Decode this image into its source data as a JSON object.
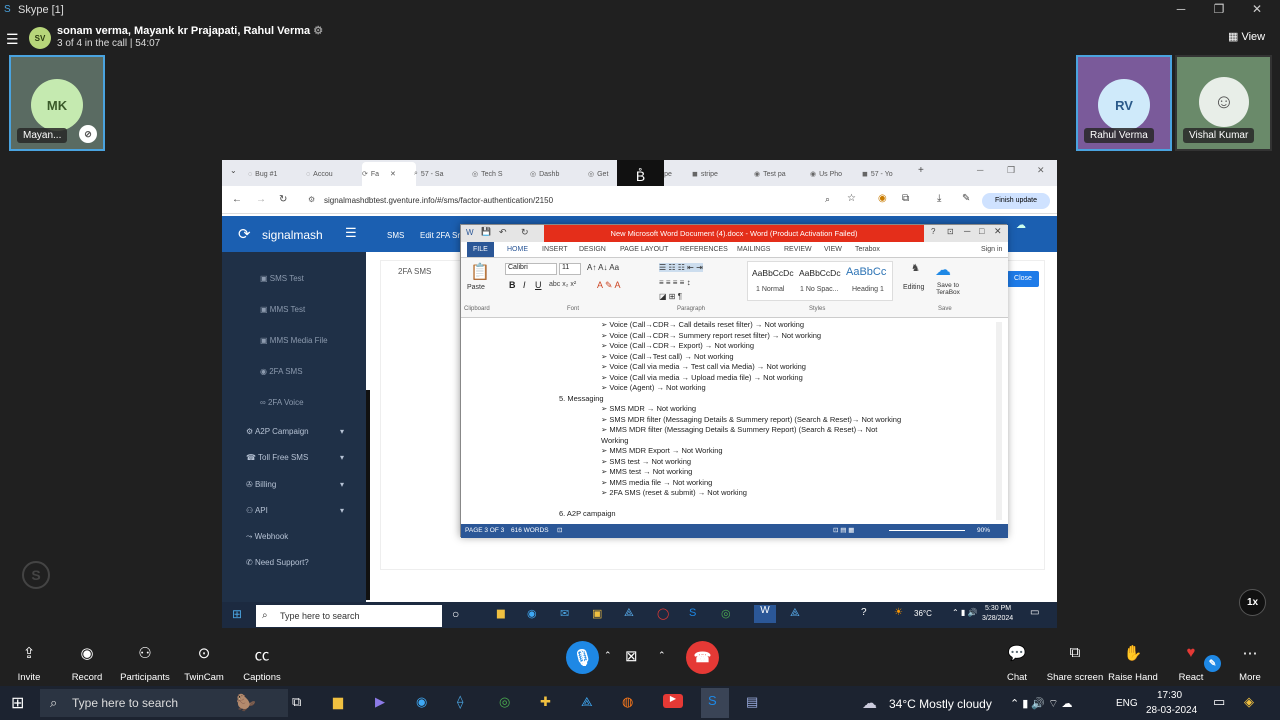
{
  "app_title": "Skype [1]",
  "call": {
    "host_initials": "SV",
    "participants": "sonam verma, Mayank kr Prajapati, Rahul Verma",
    "status": "3 of 4 in the call | 54:07",
    "view_label": "View",
    "speed_badge": "1x"
  },
  "tiles": [
    {
      "initials": "MK",
      "name": "Mayan..."
    },
    {
      "initials": "RV",
      "name": "Rahul Verma"
    },
    {
      "initials": "",
      "name": "Vishal Kumar"
    }
  ],
  "browser": {
    "tabs": [
      "Bug #1",
      "Accou",
      "Fa",
      "57 - Sa",
      "Tech S",
      "Dashb",
      "Get",
      "stripe",
      "stripe",
      "Test pa",
      "Us Pho",
      "57 - Yo"
    ],
    "url": "signalmashdbtest.gventure.info/#/sms/factor-authentication/2150",
    "finish_update": "Finish update"
  },
  "signalmash": {
    "logo": "signalmash",
    "breadcrumb_sms": "SMS",
    "breadcrumb_edit": "Edit 2FA Sr",
    "page_label": "2FA SMS",
    "close_btn": "Close",
    "menu": [
      {
        "label": "SMS Test",
        "sub": true
      },
      {
        "label": "MMS Test",
        "sub": true
      },
      {
        "label": "MMS Media File",
        "sub": true
      },
      {
        "label": "2FA SMS",
        "sub": true
      },
      {
        "label": "2FA Voice",
        "sub": true
      },
      {
        "label": "A2P Campaign",
        "sub": false
      },
      {
        "label": "Toll Free SMS",
        "sub": false
      },
      {
        "label": "Billing",
        "sub": false
      },
      {
        "label": "API",
        "sub": false
      },
      {
        "label": "Webhook",
        "sub": false
      },
      {
        "label": "Need Support?",
        "sub": false
      }
    ]
  },
  "word": {
    "title": "New Microsoft Word Document (4).docx - Word (Product Activation Failed)",
    "sign_in": "Sign in",
    "tabs": [
      "FILE",
      "HOME",
      "INSERT",
      "DESIGN",
      "PAGE LAYOUT",
      "REFERENCES",
      "MAILINGS",
      "REVIEW",
      "VIEW",
      "Terabox"
    ],
    "ribbon": {
      "paste": "Paste",
      "clipboard": "Clipboard",
      "font_name": "Calibri",
      "font_size": "11",
      "font_group": "Font",
      "paragraph_group": "Paragraph",
      "styles": [
        "1 Normal",
        "1 No Spac...",
        "Heading 1"
      ],
      "style_sample": "AaBbCcDc",
      "style_sample_heading": "AaBbCc",
      "styles_group": "Styles",
      "editing": "Editing",
      "save_to_terabox": "Save to TeraBox",
      "save_group": "Save"
    },
    "doc_lines": [
      {
        "text": "➢   Voice (Call→CDR→ Call details reset filter) → Not working",
        "lvl": 1
      },
      {
        "text": "➢   Voice (Call→CDR→ Summery report reset filter) → Not working",
        "lvl": 1
      },
      {
        "text": "➢   Voice (Call→CDR→ Export) → Not working",
        "lvl": 1
      },
      {
        "text": "➢   Voice (Call→Test call) → Not working",
        "lvl": 1
      },
      {
        "text": "➢   Voice (Call via media → Test call via Media) → Not working",
        "lvl": 1
      },
      {
        "text": "➢   Voice (Call via media → Upload media file) → Not working",
        "lvl": 1
      },
      {
        "text": "➢   Voice (Agent) → Not working",
        "lvl": 1
      },
      {
        "text": "5.     Messaging",
        "lvl": 0
      },
      {
        "text": "➢   SMS MDR → Not working",
        "lvl": 1
      },
      {
        "text": "➢   SMS MDR filter (Messaging Details & Summery report) (Search & Reset)→ Not working",
        "lvl": 1
      },
      {
        "text": "➢   MMS MDR filter (Messaging Details & Summery Report) (Search & Reset)→ Not",
        "lvl": 1
      },
      {
        "text": "      Working",
        "lvl": 1
      },
      {
        "text": "➢   MMS MDR Export → Not Working",
        "lvl": 1
      },
      {
        "text": "➢   SMS test → Not working",
        "lvl": 1
      },
      {
        "text": "➢   MMS test → Not working",
        "lvl": 1
      },
      {
        "text": "➢   MMS media file → Not working",
        "lvl": 1
      },
      {
        "text": "➢   2FA SMS (reset & submit) → Not working",
        "lvl": 1
      },
      {
        "text": "",
        "lvl": 0
      },
      {
        "text": "6.     A2P campaign",
        "lvl": 0
      }
    ],
    "status_page": "PAGE 3 OF 3",
    "status_words": "616 WORDS",
    "zoom": "90%"
  },
  "inner_taskbar": {
    "search": "Type here to search",
    "weather": "36°C",
    "time": "5:30 PM",
    "date": "3/28/2024"
  },
  "controls": {
    "left": [
      "Invite",
      "Record",
      "Participants",
      "TwinCam",
      "Captions"
    ],
    "right": [
      "Chat",
      "Share screen",
      "Raise Hand",
      "React",
      "More"
    ]
  },
  "taskbar": {
    "search": "Type here to search",
    "weather": "34°C  Mostly cloudy",
    "lang": "ENG",
    "time": "17:30",
    "date": "28-03-2024"
  },
  "colors": {
    "skype_blue": "#1e88e5",
    "end_call": "#e53935",
    "word_red": "#e42e1a",
    "signalmash_blue": "#1b5fb1"
  }
}
